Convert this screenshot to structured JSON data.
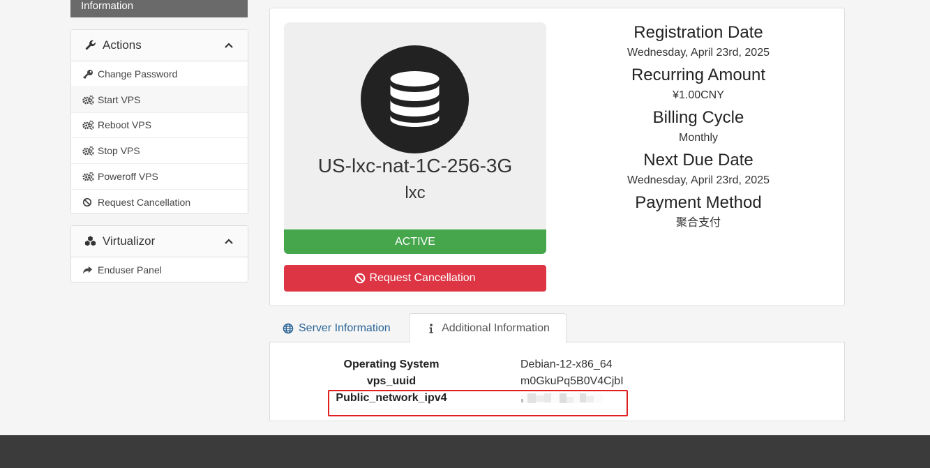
{
  "sidebar": {
    "info_tab_label": "Information",
    "actions": {
      "title": "Actions",
      "items": [
        {
          "label": "Change Password",
          "icon": "key-icon"
        },
        {
          "label": "Start VPS",
          "icon": "gears-icon"
        },
        {
          "label": "Reboot VPS",
          "icon": "gears-icon"
        },
        {
          "label": "Stop VPS",
          "icon": "gears-icon"
        },
        {
          "label": "Poweroff VPS",
          "icon": "gears-icon"
        },
        {
          "label": "Request Cancellation",
          "icon": "ban-icon"
        }
      ]
    },
    "virtualizor": {
      "title": "Virtualizor",
      "items": [
        {
          "label": "Enduser Panel",
          "icon": "share-icon"
        }
      ]
    }
  },
  "product": {
    "name": "US-lxc-nat-1C-256-3G",
    "group": "lxc",
    "status": "ACTIVE",
    "cancel_button": "Request Cancellation"
  },
  "details": {
    "registration_date_label": "Registration Date",
    "registration_date": "Wednesday, April 23rd, 2025",
    "recurring_amount_label": "Recurring Amount",
    "recurring_amount": "¥1.00CNY",
    "billing_cycle_label": "Billing Cycle",
    "billing_cycle": "Monthly",
    "next_due_label": "Next Due Date",
    "next_due": "Wednesday, April 23rd, 2025",
    "payment_method_label": "Payment Method",
    "payment_method": "聚合支付"
  },
  "tabs": {
    "server": "Server Information",
    "additional": "Additional Information"
  },
  "additional_info": {
    "rows": [
      {
        "label": "Operating System",
        "value": "Debian-12-x86_64"
      },
      {
        "label": "vps_uuid",
        "value": "m0GkuPq5B0V4CjbI"
      },
      {
        "label": "Public_network_ipv4",
        "value": ""
      }
    ]
  },
  "colors": {
    "active": "#46a64c",
    "danger": "#de3545",
    "link": "#2a6496",
    "footer": "#3b3b3b",
    "highlight": "#e02020"
  }
}
